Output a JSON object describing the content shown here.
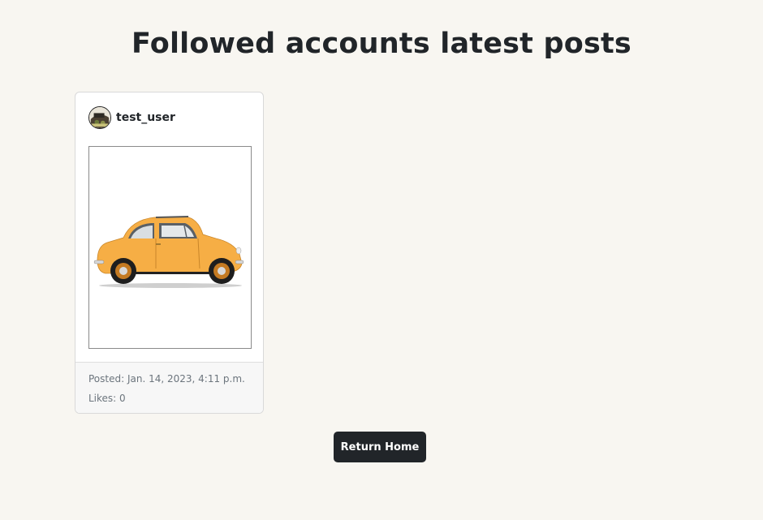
{
  "page": {
    "title": "Followed accounts latest posts"
  },
  "post": {
    "username": "test_user",
    "posted_label": "Posted: Jan. 14, 2023, 4:11 p.m.",
    "likes_label": "Likes: 0"
  },
  "actions": {
    "return_home_label": "Return Home"
  },
  "colors": {
    "background": "#f8f6f1",
    "button": "#212529",
    "car_body": "#f6ae45"
  },
  "icons": {
    "avatar": "user-avatar-image",
    "post": "yellow-car-image"
  }
}
